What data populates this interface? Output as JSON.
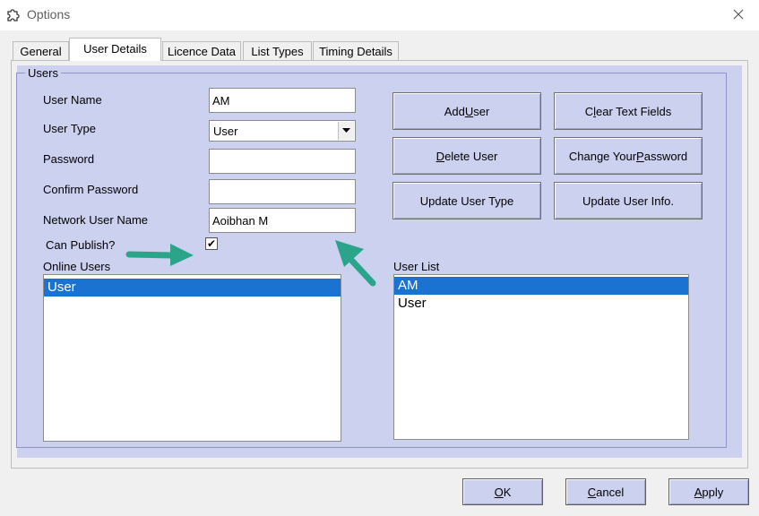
{
  "window": {
    "title": "Options",
    "close_icon": "close-icon",
    "app_icon": "puzzle-gear-icon"
  },
  "tabs": [
    {
      "label": "General"
    },
    {
      "label": "User Details",
      "active": true
    },
    {
      "label": "Licence Data"
    },
    {
      "label": "List Types"
    },
    {
      "label": "Timing Details"
    }
  ],
  "colors": {
    "panel": "#cdd1f0",
    "selection": "#1a73d0",
    "arrow": "#2aa58a"
  },
  "users_group": {
    "label": "Users",
    "user_name": {
      "label": "User Name",
      "value": "AM"
    },
    "user_type": {
      "label": "User Type",
      "value": "User"
    },
    "password": {
      "label": "Password",
      "value": ""
    },
    "confirm_password": {
      "label": "Confirm Password",
      "value": ""
    },
    "network_user_name": {
      "label": "Network User Name",
      "value": "Aoibhan M"
    },
    "can_publish": {
      "label": "Can Publish?",
      "checked": true,
      "mark": "✔"
    },
    "buttons": {
      "add_user": {
        "pre": "Add ",
        "key": "U",
        "post": "ser"
      },
      "clear_text_fields": {
        "pre": "C",
        "key": "l",
        "post": "ear Text Fields"
      },
      "delete_user": {
        "pre": "",
        "key": "D",
        "post": "elete User"
      },
      "change_password": {
        "pre": "Change Your ",
        "key": "P",
        "post": "assword"
      },
      "update_user_type": {
        "label": "Update User Type"
      },
      "update_user_info": {
        "label": "Update User Info."
      }
    },
    "online_users": {
      "label": "Online Users",
      "items": [
        "User"
      ],
      "selected_index": 0
    },
    "user_list": {
      "label": "User List",
      "items": [
        "AM",
        "User"
      ],
      "selected_index": 0
    }
  },
  "dialog_buttons": {
    "ok": {
      "pre": "",
      "key": "O",
      "post": "K"
    },
    "cancel": {
      "pre": "",
      "key": "C",
      "post": "ancel"
    },
    "apply": {
      "pre": "",
      "key": "A",
      "post": "pply"
    }
  }
}
